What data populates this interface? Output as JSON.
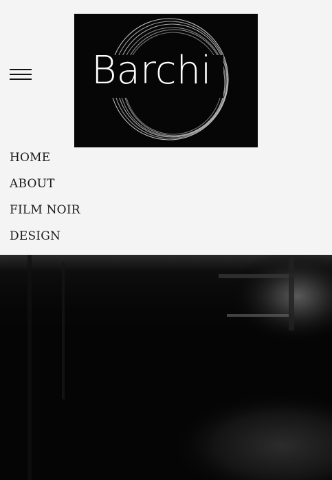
{
  "logo": {
    "text": "Barchi",
    "background": "#060606",
    "ring_color": "#cfcfcf"
  },
  "menu_icon": "hamburger-icon",
  "nav": {
    "items": [
      {
        "label": "HOME"
      },
      {
        "label": "ABOUT"
      },
      {
        "label": "FILM NOIR"
      },
      {
        "label": "DESIGN"
      }
    ]
  },
  "colors": {
    "page_background": "#f4f4f4",
    "nav_text": "#1a1a1a",
    "hero_base": "#050505"
  }
}
